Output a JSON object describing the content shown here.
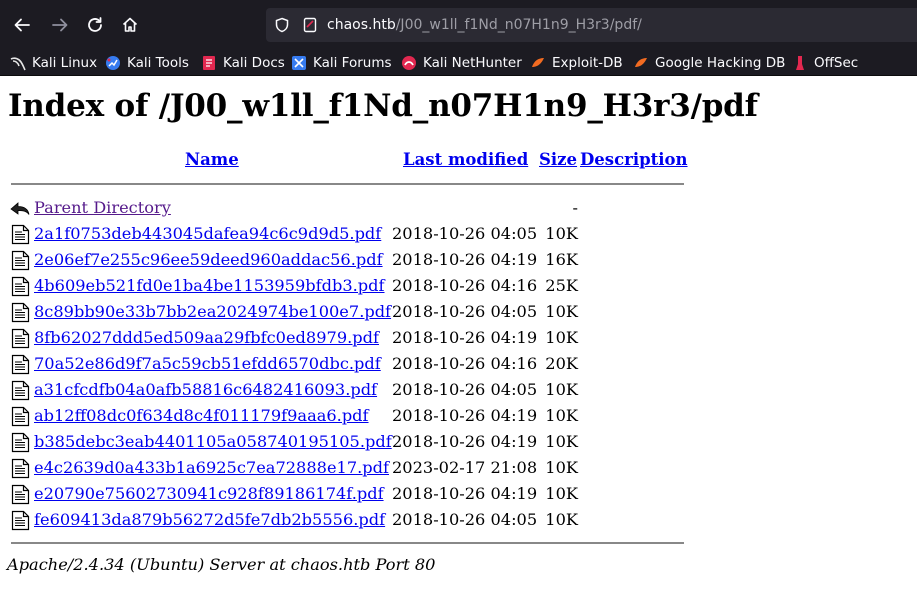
{
  "browser": {
    "url_host": "chaos.htb",
    "url_path": "/J00_w1ll_f1Nd_n07H1n9_H3r3/pdf/",
    "nav_icons": [
      "back-icon",
      "forward-icon",
      "reload-icon",
      "home-icon"
    ],
    "bookmarks": [
      {
        "label": "Kali Linux",
        "icon": "kali-dragon-icon"
      },
      {
        "label": "Kali Tools",
        "icon": "kali-tools-icon"
      },
      {
        "label": "Kali Docs",
        "icon": "kali-docs-icon"
      },
      {
        "label": "Kali Forums",
        "icon": "kali-forums-icon"
      },
      {
        "label": "Kali NetHunter",
        "icon": "nethunter-icon"
      },
      {
        "label": "Exploit-DB",
        "icon": "exploit-db-icon"
      },
      {
        "label": "Google Hacking DB",
        "icon": "ghdb-icon"
      },
      {
        "label": "OffSec",
        "icon": "offsec-icon"
      }
    ],
    "colors": {
      "chrome": "#1c1b22",
      "urlbar": "#2b2a33",
      "link": "#0000ee",
      "visited": "#551a8b"
    }
  },
  "page": {
    "title": "Index of /J00_w1ll_f1Nd_n07H1n9_H3r3/pdf",
    "headers": {
      "name": "Name",
      "last_modified": "Last modified",
      "size": "Size",
      "description": "Description"
    },
    "parent": {
      "name": "Parent Directory",
      "date": "",
      "size": "-"
    },
    "rows": [
      {
        "name": "2a1f0753deb443045dafea94c6c9d9d5.pdf",
        "date": "2018-10-26 04:05",
        "size": "10K"
      },
      {
        "name": "2e06ef7e255c96ee59deed960addac56.pdf",
        "date": "2018-10-26 04:19",
        "size": "16K"
      },
      {
        "name": "4b609eb521fd0e1ba4be1153959bfdb3.pdf",
        "date": "2018-10-26 04:16",
        "size": "25K"
      },
      {
        "name": "8c89bb90e33b7bb2ea2024974be100e7.pdf",
        "date": "2018-10-26 04:05",
        "size": "10K"
      },
      {
        "name": "8fb62027ddd5ed509aa29fbfc0ed8979.pdf",
        "date": "2018-10-26 04:19",
        "size": "10K"
      },
      {
        "name": "70a52e86d9f7a5c59cb51efdd6570dbc.pdf",
        "date": "2018-10-26 04:16",
        "size": "20K"
      },
      {
        "name": "a31cfcdfb04a0afb58816c6482416093.pdf",
        "date": "2018-10-26 04:05",
        "size": "10K"
      },
      {
        "name": "ab12ff08dc0f634d8c4f011179f9aaa6.pdf",
        "date": "2018-10-26 04:19",
        "size": "10K"
      },
      {
        "name": "b385debc3eab4401105a058740195105.pdf",
        "date": "2018-10-26 04:19",
        "size": "10K"
      },
      {
        "name": "e4c2639d0a433b1a6925c7ea72888e17.pdf",
        "date": "2023-02-17 21:08",
        "size": "10K"
      },
      {
        "name": "e20790e75602730941c928f89186174f.pdf",
        "date": "2018-10-26 04:19",
        "size": "10K"
      },
      {
        "name": "fe609413da879b56272d5fe7db2b5556.pdf",
        "date": "2018-10-26 04:05",
        "size": "10K"
      }
    ],
    "footer": "Apache/2.4.34 (Ubuntu) Server at chaos.htb Port 80"
  }
}
